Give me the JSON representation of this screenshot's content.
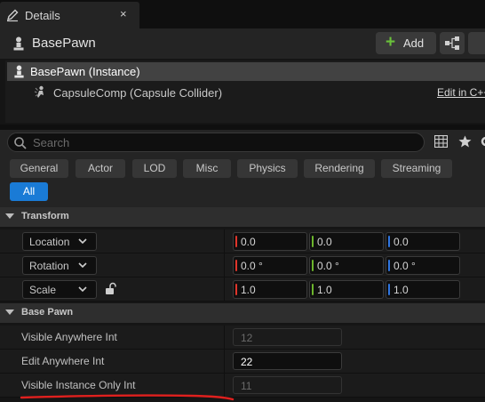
{
  "tab": {
    "title": "Details",
    "close_glyph": "×"
  },
  "header": {
    "actor_name": "BasePawn",
    "add_label": "Add",
    "add_glyph": "+"
  },
  "tree": {
    "instance_label": "BasePawn (Instance)",
    "component_label": "CapsuleComp (Capsule Collider)",
    "edit_link": "Edit in C++"
  },
  "search": {
    "placeholder": "Search"
  },
  "categories": [
    "General",
    "Actor",
    "LOD",
    "Misc",
    "Physics",
    "Rendering",
    "Streaming"
  ],
  "category_all": "All",
  "transform": {
    "title": "Transform",
    "rows": [
      {
        "label": "Location",
        "values": [
          "0.0",
          "0.0",
          "0.0"
        ]
      },
      {
        "label": "Rotation",
        "values": [
          "0.0 °",
          "0.0 °",
          "0.0 °"
        ]
      },
      {
        "label": "Scale",
        "values": [
          "1.0",
          "1.0",
          "1.0"
        ]
      }
    ]
  },
  "axis_colors": {
    "x": "#e0352b",
    "y": "#6cb52c",
    "z": "#2e75e0"
  },
  "base_pawn": {
    "title": "Base Pawn",
    "rows": [
      {
        "label": "Visible Anywhere Int",
        "value": "12",
        "editable": false
      },
      {
        "label": "Edit Anywhere Int",
        "value": "22",
        "editable": true
      },
      {
        "label": "Visible Instance Only Int",
        "value": "11",
        "editable": false
      }
    ]
  },
  "colors": {
    "accent": "#1a7bd6",
    "add_plus": "#6ac13a",
    "annotation": "#e0201e"
  }
}
